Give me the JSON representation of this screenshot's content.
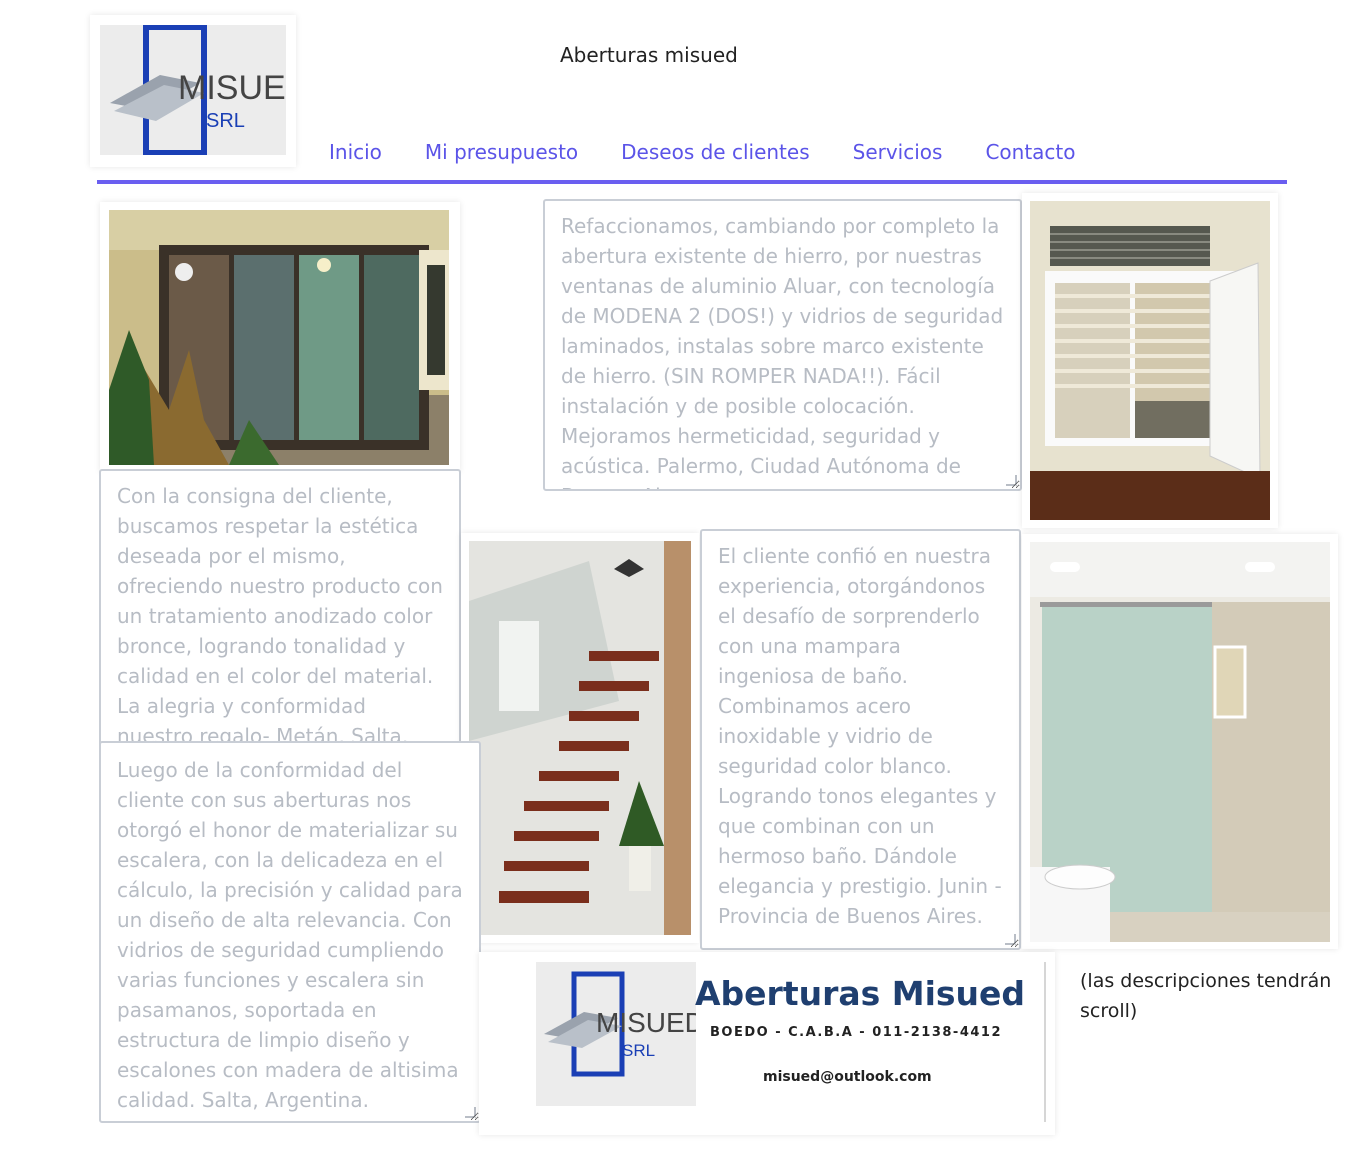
{
  "header": {
    "title": "Aberturas misued",
    "logo": {
      "brand": "MISUED",
      "sub": "SRL"
    }
  },
  "nav": {
    "items": [
      {
        "label": "Inicio"
      },
      {
        "label": "Mi presupuesto"
      },
      {
        "label": "Deseos de clientes"
      },
      {
        "label": "Servicios"
      },
      {
        "label": "Contacto"
      }
    ]
  },
  "projects": [
    {
      "description": "Refaccionamos, cambiando por completo la abertura existente de hierro, por nuestras ventanas de aluminio Aluar, con tecnología de MODENA 2 (DOS!) y vidrios de seguridad laminados, instalas sobre marco existente de hierro. (SIN ROMPER NADA!!). Fácil instalación y de posible colocación. Mejoramos hermeticidad, seguridad y acústica. Palermo, Ciudad Autónoma de Buenos Aires."
    },
    {
      "description": "Con la consigna del cliente, buscamos respetar la estética deseada por el mismo, ofreciendo nuestro producto con un tratamiento anodizado color bronce, logrando tonalidad y calidad en el color del material. La alegria y conformidad nuestro regalo- Metán, Salta, Argentina"
    },
    {
      "description": "El cliente confió en nuestra experiencia, otorgándonos el desafío de sorprenderlo con una mampara ingeniosa de baño. Combinamos acero inoxidable y vidrio de seguridad color blanco. Logrando tonos elegantes y que combinan con un hermoso baño. Dándole elegancia y prestigio. Junin - Provincia de Buenos Aires."
    },
    {
      "description": "Luego de la conformidad del cliente con sus aberturas nos otorgó el honor de materializar su escalera, con la delicadeza en el cálculo, la precisión y calidad para un diseño de alta relevancia. Con vidrios de seguridad cumpliendo varias funciones y escalera sin pasamanos, soportada en estructura de limpio diseño y escalones con madera de altisima calidad. Salta, Argentina."
    }
  ],
  "footer_card": {
    "brand": "Aberturas Misued",
    "address": "BOEDO - C.A.B.A - 011-2138-4412",
    "email": "misued@outlook.com",
    "logo": {
      "brand": "MISUED",
      "sub": "SRL"
    }
  },
  "note": "(las descripciones tendrán scroll)",
  "colors": {
    "nav": "#5b54e8",
    "nav_bar": "#6a5ef0",
    "logo_blue": "#1a3fb5",
    "footer_brand": "#1f3f70"
  }
}
